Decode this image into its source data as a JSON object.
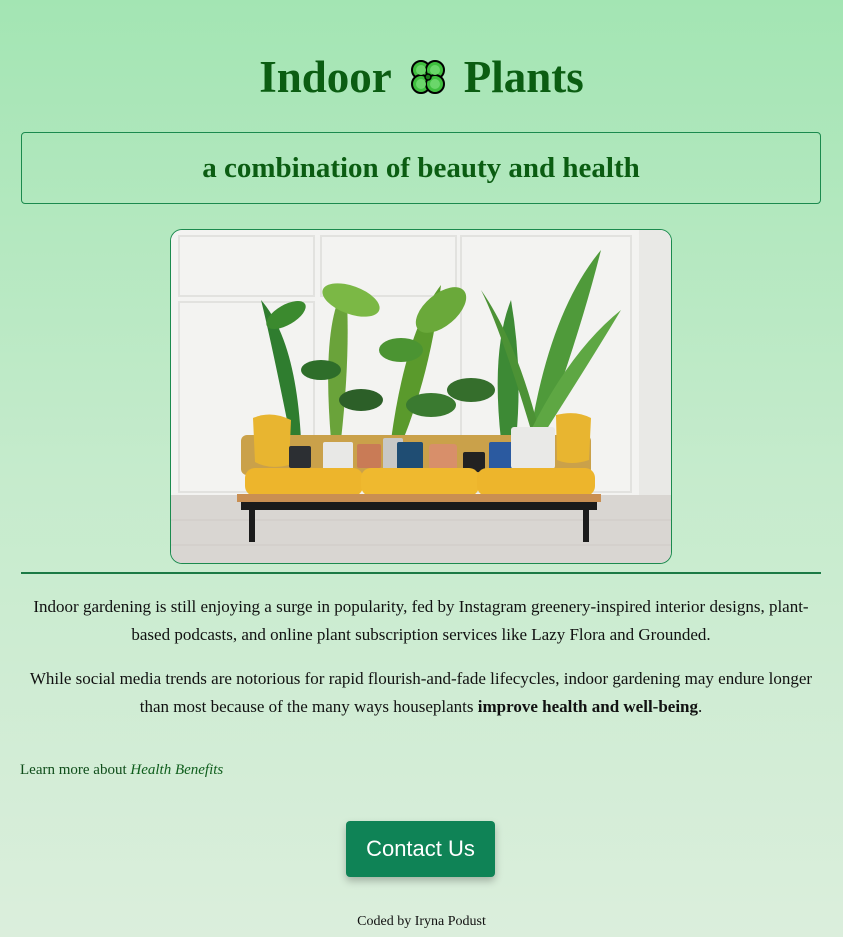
{
  "header": {
    "title_left": "Indoor",
    "title_right": "Plants",
    "title_icon": "four-leaf-clover-icon",
    "tagline": "a combination of beauty and health"
  },
  "colors": {
    "title_green": "#0b5d12",
    "accent_green": "#1b8a4e",
    "button_green": "#0f8356",
    "background_top": "#a3e5b3",
    "background_bottom": "#dbeedc"
  },
  "hero": {
    "image": "potted-plants-on-yellow-sofa-photo"
  },
  "intro": {
    "p1": "Indoor gardening is still enjoying a surge in popularity, fed by Instagram greenery-inspired interior designs, plant-based podcasts, and online plant subscription services like Lazy Flora and Grounded.",
    "p2_before": "While social media trends are notorious for rapid flourish-and-fade lifecycles, indoor gardening may endure longer than most because of the many ways houseplants ",
    "p2_bold": "improve health and well-being",
    "p2_after": "."
  },
  "learn_more": {
    "prefix": "Learn more about ",
    "link": "Health Benefits"
  },
  "contact_button": "Contact Us",
  "footer": "Coded by Iryna Podust"
}
